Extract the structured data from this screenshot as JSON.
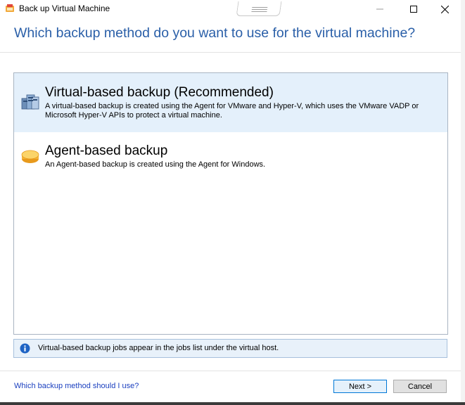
{
  "window": {
    "title": "Back up Virtual Machine"
  },
  "header": {
    "heading": "Which backup method do you want to use for the virtual machine?"
  },
  "options": [
    {
      "title": "Virtual-based backup (Recommended)",
      "description": "A virtual-based backup is created using the Agent for VMware and Hyper-V, which uses the VMware VADP or Microsoft Hyper-V APIs to protect a virtual machine.",
      "icon": "virtual-server-icon",
      "selected": true
    },
    {
      "title": "Agent-based backup",
      "description": "An Agent-based backup is created using the Agent for Windows.",
      "icon": "agent-disk-icon",
      "selected": false
    }
  ],
  "info": {
    "text": "Virtual-based backup jobs appear in the jobs list under the virtual host.",
    "icon": "info-icon"
  },
  "footer": {
    "help_link": "Which backup method should I use?",
    "next_label": "Next >",
    "cancel_label": "Cancel"
  },
  "colors": {
    "heading": "#2a5fa8",
    "selected_bg": "#e4f0fb",
    "link": "#1a3fbf"
  }
}
